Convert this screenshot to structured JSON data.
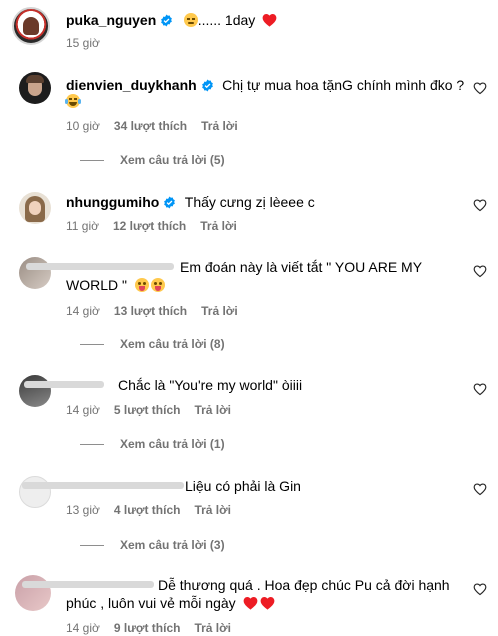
{
  "post": {
    "username": "puka_nguyen",
    "caption_suffix": "...... 1day",
    "time": "15 giờ"
  },
  "comments": [
    {
      "username": "dienvien_duykhanh",
      "text": "Chị tự mua hoa tặnG chính mình đko ?",
      "time": "10 giờ",
      "likes": "34 lượt thích",
      "reply": "Trả lời",
      "view_replies": "Xem câu trả lời (5)"
    },
    {
      "username": "nhunggumiho",
      "text": "Thấy cưng zị lèeee c",
      "time": "11 giờ",
      "likes": "12 lượt thích",
      "reply": "Trả lời"
    },
    {
      "text_line1": "Em đoán này là viết tắt \" YOU ARE MY",
      "text_line2": "WORLD \"",
      "time": "14 giờ",
      "likes": "13 lượt thích",
      "reply": "Trả lời",
      "view_replies": "Xem câu trả lời (8)"
    },
    {
      "text": "Chắc là \"You're my world\" òiiii",
      "time": "14 giờ",
      "likes": "5 lượt thích",
      "reply": "Trả lời",
      "view_replies": "Xem câu trả lời (1)"
    },
    {
      "text": "Liệu có phải là Gin",
      "time": "13 giờ",
      "likes": "4 lượt thích",
      "reply": "Trả lời",
      "view_replies": "Xem câu trả lời (3)"
    },
    {
      "text_line1": "Dễ thương quá . Hoa đẹp chúc Pu cả đời hạnh",
      "text_line2": "phúc , luôn vui vẻ mỗi ngày",
      "time": "14 giờ",
      "likes": "9 lượt thích",
      "reply": "Trả lời"
    }
  ],
  "colors": {
    "verified": "#0095f6",
    "heart": "#ed1c24",
    "meta": "#737373"
  }
}
